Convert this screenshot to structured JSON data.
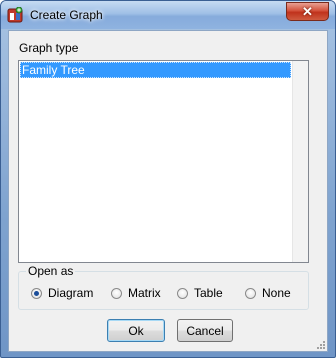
{
  "window": {
    "title": "Create Graph",
    "close_glyph": "✕",
    "app_icon": "graph-app-icon"
  },
  "graph_type": {
    "label": "Graph type",
    "items": [
      "Family Tree"
    ],
    "selected_index": 0
  },
  "open_as": {
    "legend": "Open as",
    "options": [
      "Diagram",
      "Matrix",
      "Table",
      "None"
    ],
    "selected": "Diagram"
  },
  "buttons": {
    "ok": "Ok",
    "cancel": "Cancel"
  },
  "colors": {
    "selection": "#3399ff",
    "close_button": "#c0321c"
  }
}
